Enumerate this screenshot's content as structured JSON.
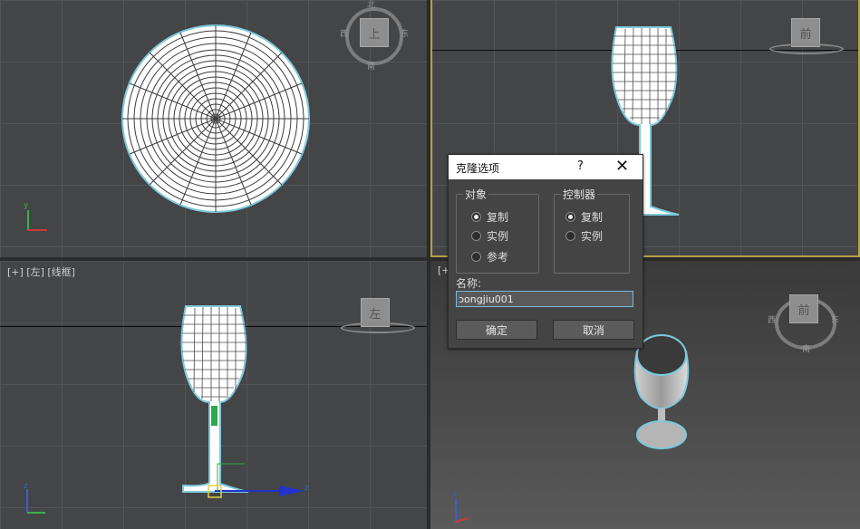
{
  "viewports": {
    "top": {
      "label": "",
      "cube_face": "上",
      "dir_n": "北",
      "dir_w": "西",
      "dir_e": "东",
      "dir_s": "南"
    },
    "front": {
      "label": "",
      "cube_face": "前"
    },
    "left": {
      "label": "[+] [左] [线框]",
      "cube_face": "左"
    },
    "persp": {
      "label": "[+",
      "cube_face": "前",
      "dir_w": "西",
      "dir_e": "东",
      "dir_s": "南"
    }
  },
  "axes": {
    "x": "x",
    "y": "y",
    "z": "z"
  },
  "dialog": {
    "title": "克隆选项",
    "help": "?",
    "close": "✕",
    "object_group": {
      "title": "对象",
      "options": [
        "复制",
        "实例",
        "参考"
      ],
      "selected": "复制"
    },
    "controller_group": {
      "title": "控制器",
      "options": [
        "复制",
        "实例"
      ],
      "selected": "复制"
    },
    "name_label": "名称:",
    "name_value": "ɔongjiu001",
    "ok": "确定",
    "cancel": "取消"
  },
  "colors": {
    "viewport_bg": "#444546",
    "active_border": "#b3a24a",
    "wireframe": "#ffffff",
    "selection_outline": "#7ec8dc",
    "dialog_bg": "#444444",
    "input_border": "#7fb6d8"
  }
}
